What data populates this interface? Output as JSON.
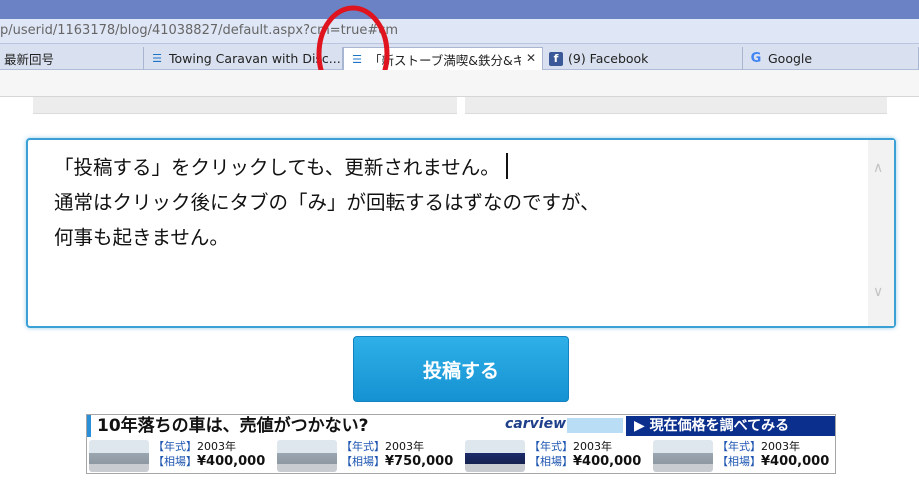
{
  "address_bar": {
    "url": "p/userid/1163178/blog/41038827/default.aspx?cm=true#cm"
  },
  "tabs": [
    {
      "label": "最新回号",
      "icon": "none",
      "active": false
    },
    {
      "label": "Towing Caravan with Disc...",
      "icon": "blog-icon",
      "active": false
    },
    {
      "label": "「新ストーブ満喫&鉄分&キャ...",
      "icon": "blog-icon",
      "active": true,
      "close": "✕"
    },
    {
      "label": "(9) Facebook",
      "icon": "facebook-icon",
      "active": false
    },
    {
      "label": "Google",
      "icon": "google-icon",
      "active": false
    }
  ],
  "editor": {
    "lines": [
      "「投稿する」をクリックしても、更新されません。",
      "通常はクリック後にタブの「み」が回転するはずなのですが、",
      "何事も起きません。"
    ]
  },
  "post_button": {
    "label": "投稿する"
  },
  "ad": {
    "headline": "10年落ちの車は、売値がつかない?",
    "brand": "carview",
    "cta": "▶ 現在価格を調べてみる",
    "cars": [
      {
        "year_label": "【年式】",
        "year": "2003年",
        "price_label": "【相場】",
        "price": "¥400,000"
      },
      {
        "year_label": "【年式】",
        "year": "2003年",
        "price_label": "【相場】",
        "price": "¥750,000"
      },
      {
        "year_label": "【年式】",
        "year": "2003年",
        "price_label": "【相場】",
        "price": "¥400,000"
      },
      {
        "year_label": "【年式】",
        "year": "2003年",
        "price_label": "【相場】",
        "price": "¥400,000"
      }
    ]
  },
  "colors": {
    "accent_blue": "#1c9ad9",
    "titlebar": "#6b83c4",
    "annotation_red": "#e0141e"
  }
}
